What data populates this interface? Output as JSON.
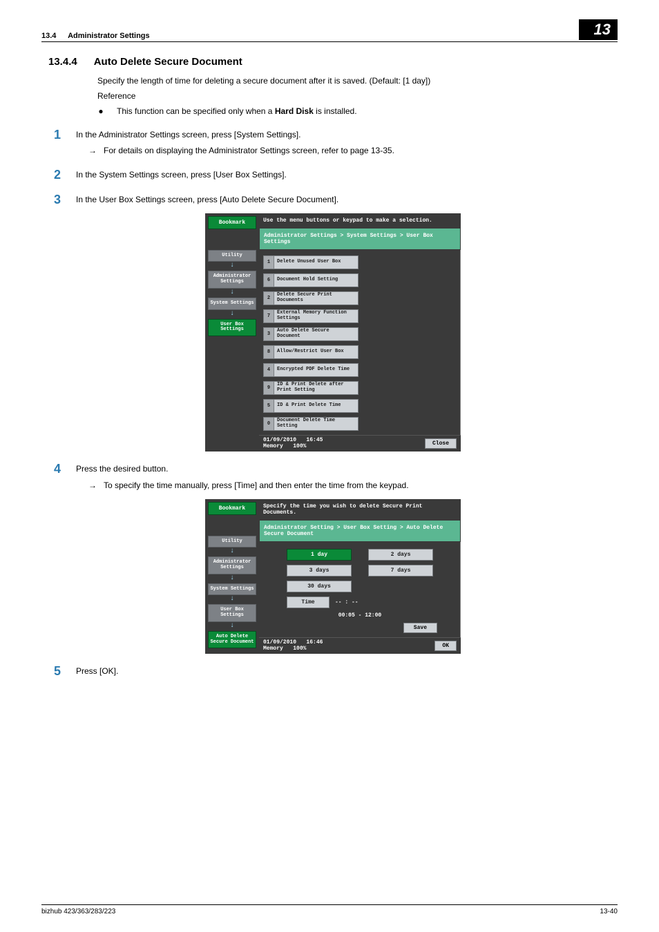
{
  "header": {
    "section_number": "13.4",
    "section_title": "Administrator Settings",
    "chapter_badge": "13"
  },
  "section": {
    "number": "13.4.4",
    "title": "Auto Delete Secure Document",
    "intro": "Specify the length of time for deleting a secure document after it is saved. (Default: [1 day])",
    "reference_label": "Reference",
    "bullet_prefix": "This function can be specified only when a ",
    "bullet_bold": "Hard Disk",
    "bullet_suffix": " is installed."
  },
  "steps": {
    "s1": {
      "text": "In the Administrator Settings screen, press [System Settings].",
      "sub": "For details on displaying the Administrator Settings screen, refer to page 13-35."
    },
    "s2": {
      "text": "In the System Settings screen, press [User Box Settings]."
    },
    "s3": {
      "text": "In the User Box Settings screen, press [Auto Delete Secure Document]."
    },
    "s4": {
      "text": "Press the desired button.",
      "sub": "To specify the time manually, press [Time] and then enter the time from the keypad."
    },
    "s5": {
      "text": "Press [OK]."
    }
  },
  "device1": {
    "instruction": "Use the menu buttons or keypad to make a selection.",
    "bookmark": "Bookmark",
    "nav": [
      "Utility",
      "Administrator Settings",
      "System Settings",
      "User Box Settings"
    ],
    "breadcrumb": "Administrator Settings > System Settings > User Box Settings",
    "buttons": [
      {
        "n": "1",
        "label": "Delete Unused User Box"
      },
      {
        "n": "6",
        "label": "Document Hold Setting"
      },
      {
        "n": "2",
        "label": "Delete Secure Print Documents"
      },
      {
        "n": "7",
        "label": "External Memory Function Settings"
      },
      {
        "n": "3",
        "label": "Auto Delete Secure Document"
      },
      {
        "n": "8",
        "label": "Allow/Restrict User Box"
      },
      {
        "n": "4",
        "label": "Encrypted PDF Delete Time"
      },
      {
        "n": "9",
        "label": "ID & Print Delete after Print Setting"
      },
      {
        "n": "5",
        "label": "ID & Print Delete Time"
      },
      {
        "n": "0",
        "label": "Document Delete Time Setting"
      }
    ],
    "footer_date": "01/09/2010",
    "footer_time": "16:45",
    "footer_mem_label": "Memory",
    "footer_mem_val": "100%",
    "close": "Close"
  },
  "device2": {
    "instruction": "Specify the time you wish to delete Secure Print Documents.",
    "bookmark": "Bookmark",
    "nav": [
      "Utility",
      "Administrator Settings",
      "System Settings",
      "User Box Settings",
      "Auto Delete Secure Document"
    ],
    "breadcrumb": "Administrator Setting > User Box Setting > Auto Delete Secure Document",
    "options": {
      "r1a": "1 day",
      "r1b": "2 days",
      "r2a": "3 days",
      "r2b": "7 days",
      "r3a": "30 days",
      "time_label": "Time",
      "time_value": "-- : --",
      "range": "00:05  -  12:00",
      "save": "Save"
    },
    "footer_date": "01/09/2010",
    "footer_time": "16:46",
    "footer_mem_label": "Memory",
    "footer_mem_val": "100%",
    "ok": "OK"
  },
  "footer": {
    "model": "bizhub 423/363/283/223",
    "page": "13-40"
  }
}
